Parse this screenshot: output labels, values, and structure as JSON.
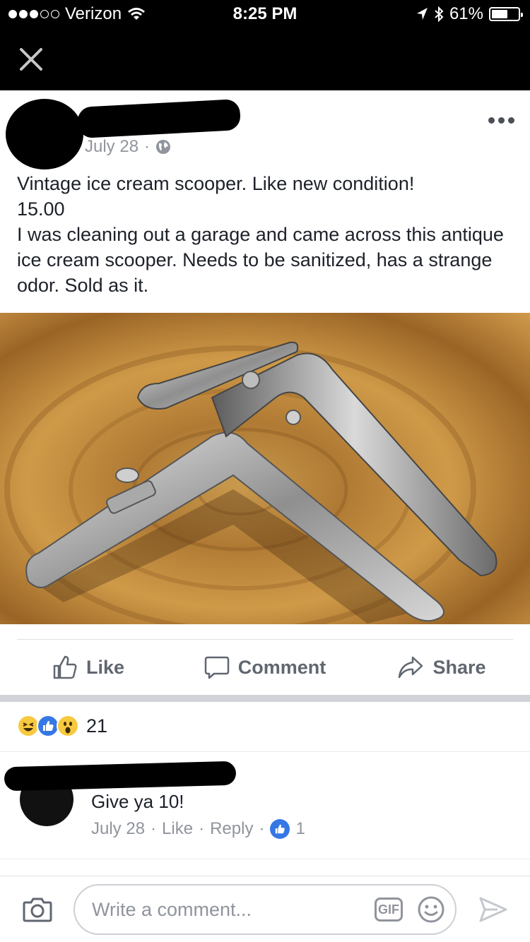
{
  "status_bar": {
    "carrier": "Verizon",
    "time": "8:25 PM",
    "battery": "61%",
    "battery_level": 0.61
  },
  "post": {
    "date": "July 28",
    "text_lines": [
      "Vintage ice cream scooper. Like new condition!",
      "15.00",
      "I was cleaning out a garage and came across this antique ice cream scooper. Needs to be sanitized, has a strange odor. Sold as it."
    ]
  },
  "actions": {
    "like": "Like",
    "comment": "Comment",
    "share": "Share"
  },
  "reactions": {
    "count": "21",
    "types": [
      "haha",
      "like",
      "wow"
    ]
  },
  "comment": {
    "text": "Give ya 10!",
    "date": "July 28",
    "like": "Like",
    "reply": "Reply",
    "like_count": "1"
  },
  "composer": {
    "placeholder": "Write a comment...",
    "gif": "GIF"
  },
  "colors": {
    "brand_blue": "#3578e5",
    "meta_gray": "#90949c",
    "action_gray": "#616770",
    "reaction_yellow": "#f7c93f"
  }
}
